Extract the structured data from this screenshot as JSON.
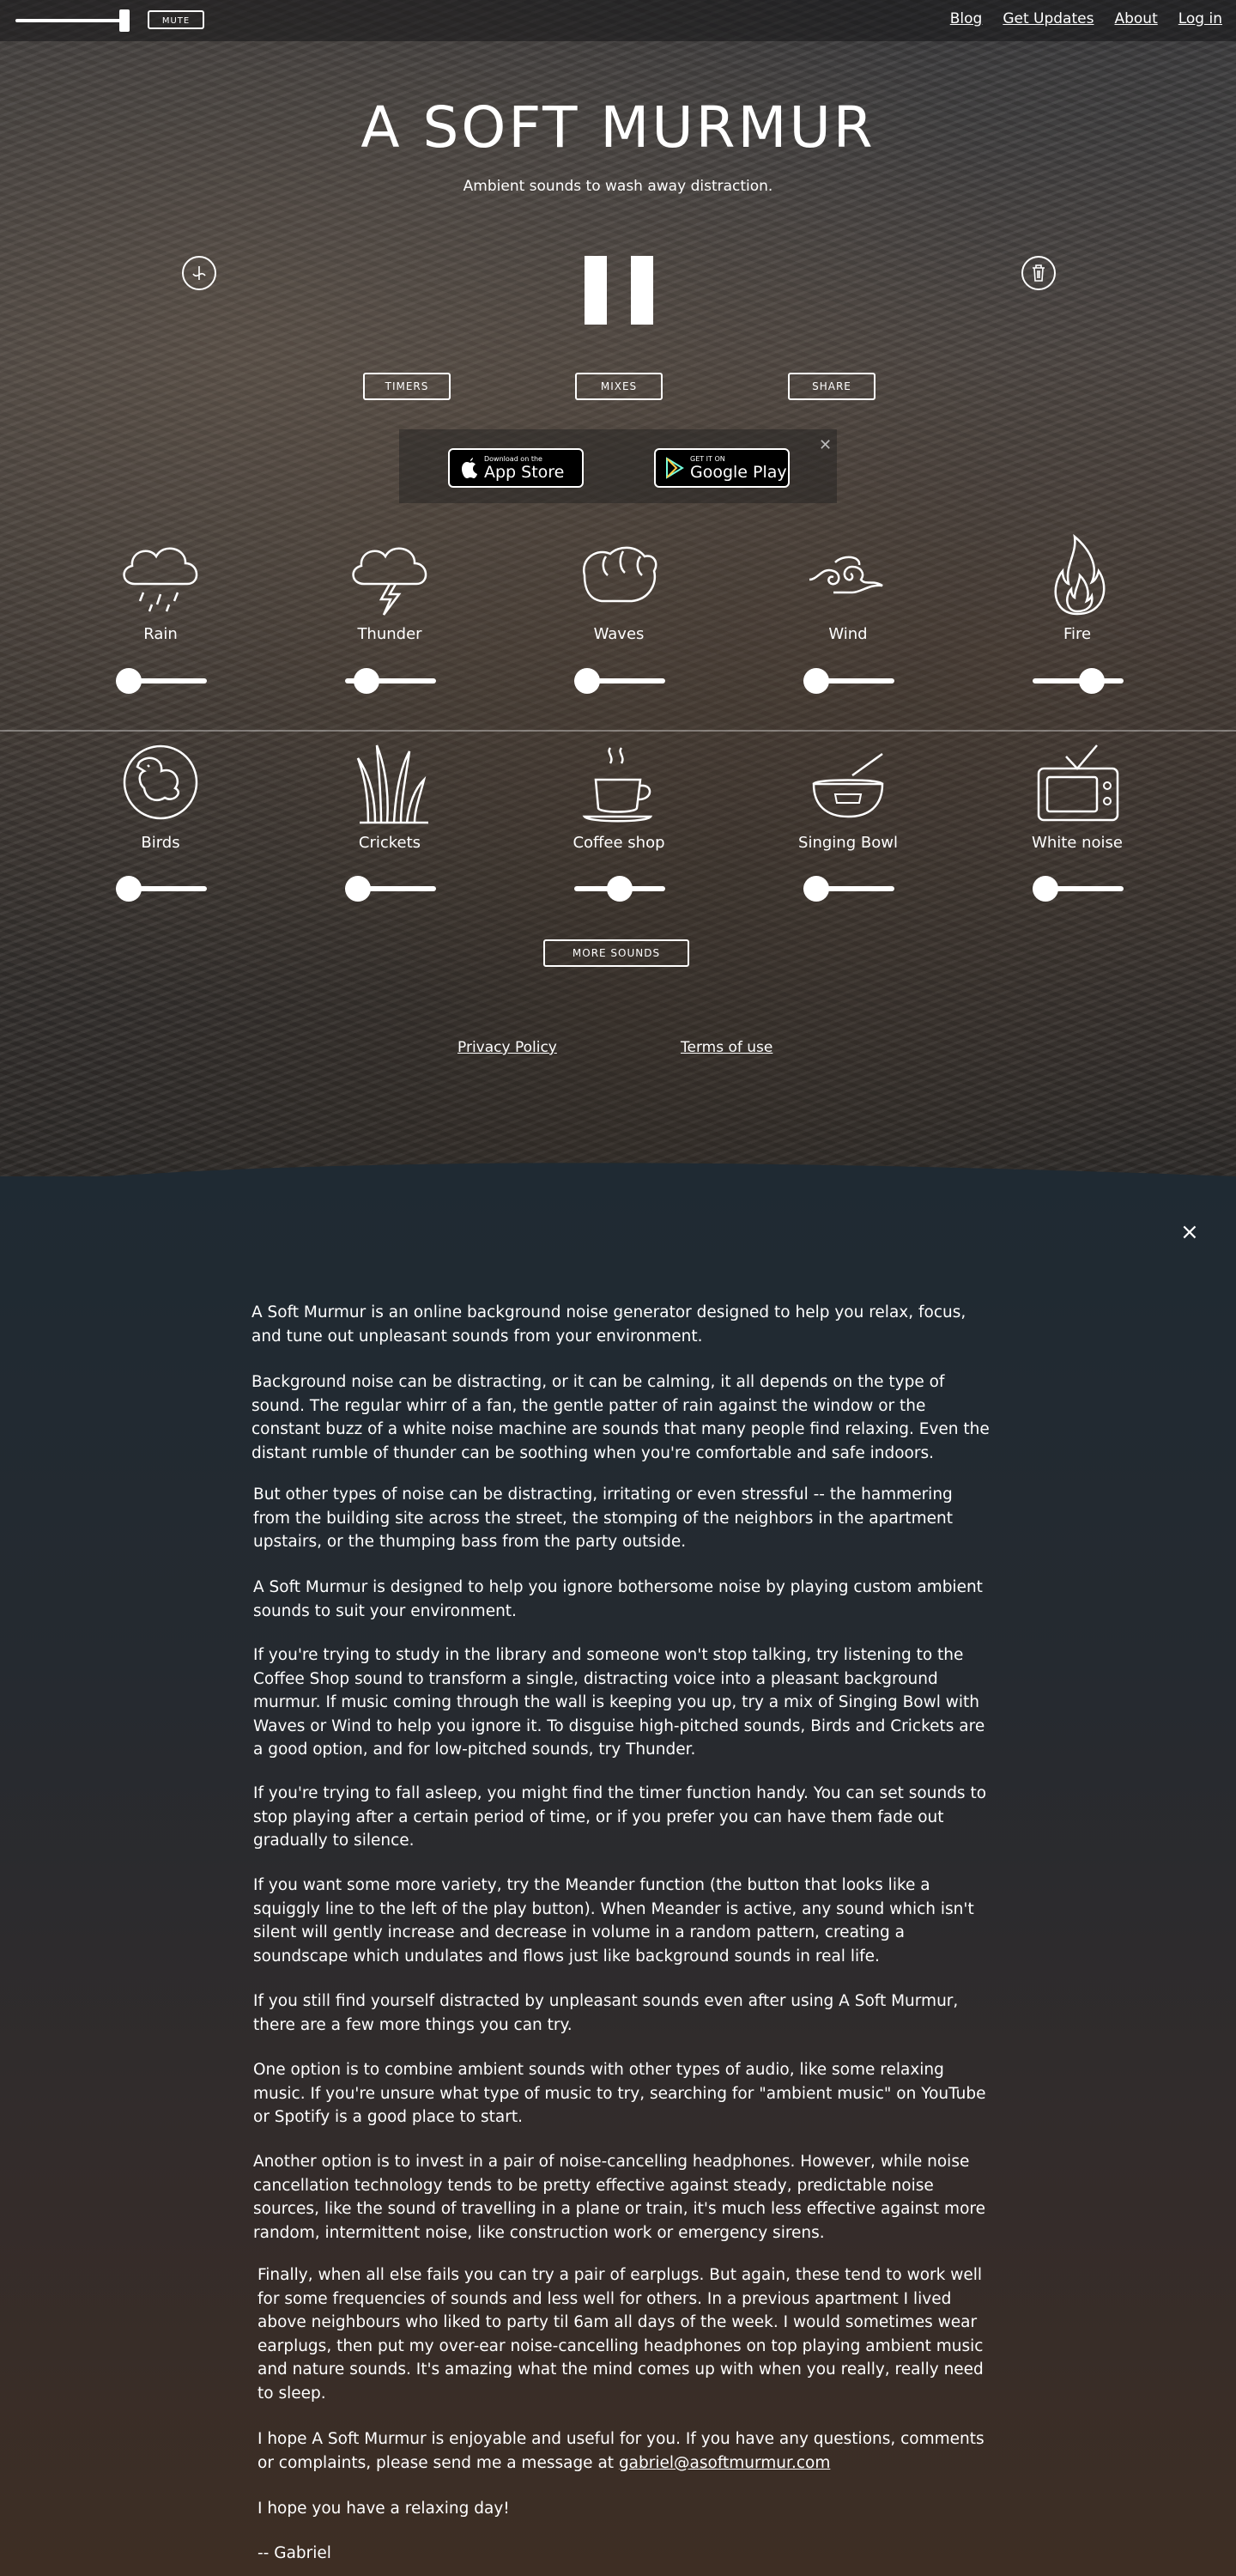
{
  "header": {
    "mute_label": "MUTE",
    "volume_level": 0.95,
    "nav": [
      "Blog",
      "Get Updates",
      "About",
      "Log in"
    ]
  },
  "hero": {
    "title": "A SOFT MURMUR",
    "subtitle": "Ambient sounds to wash away distraction."
  },
  "controls": {
    "timers": "TIMERS",
    "mixes": "MIXES",
    "share": "SHARE",
    "meander_icon": "meander-icon",
    "trash_icon": "trash-icon",
    "play_state": "pause"
  },
  "apps": {
    "app_store_small": "Download on the",
    "app_store_big": "App Store",
    "google_small": "GET IT ON",
    "google_big": "Google Play",
    "close": "✕"
  },
  "sounds": [
    {
      "label": "Rain",
      "icon": "rain-cloud-icon",
      "level": 0.1
    },
    {
      "label": "Thunder",
      "icon": "thunder-cloud-icon",
      "level": 0.25
    },
    {
      "label": "Waves",
      "icon": "waves-icon",
      "level": 0.1
    },
    {
      "label": "Wind",
      "icon": "wind-icon",
      "level": 0.1
    },
    {
      "label": "Fire",
      "icon": "fire-icon",
      "level": 0.7
    },
    {
      "label": "Birds",
      "icon": "bird-icon",
      "level": 0.0
    },
    {
      "label": "Crickets",
      "icon": "crickets-icon",
      "level": 0.15
    },
    {
      "label": "Coffee shop",
      "icon": "coffee-cup-icon",
      "level": 0.5
    },
    {
      "label": "Singing Bowl",
      "icon": "singing-bowl-icon",
      "level": 0.0
    },
    {
      "label": "White noise",
      "icon": "tv-icon",
      "level": 0.0
    }
  ],
  "more_sounds": "MORE SOUNDS",
  "footer": {
    "privacy": "Privacy Policy",
    "terms": "Terms of use"
  },
  "about": {
    "close": "×",
    "paragraphs": [
      "A Soft Murmur is an online background noise generator designed to help you relax, focus, and tune out unpleasant sounds from your environment.",
      "Background noise can be distracting, or it can be calming, it all depends on the type of sound. The regular whirr of a fan, the gentle patter of rain against the window or the constant buzz of a white noise machine are sounds that many people find relaxing. Even the distant rumble of thunder can be soothing when you're comfortable and safe indoors.",
      "But other types of noise can be distracting, irritating or even stressful -- the hammering from the building site across the street, the stomping of the neighbors in the apartment upstairs, or the thumping bass from the party outside.",
      "A Soft Murmur is designed to help you ignore bothersome noise by playing custom ambient sounds to suit your environment.",
      "If you're trying to study in the library and someone won't stop talking, try listening to the Coffee Shop sound to transform a single, distracting voice into a pleasant background murmur. If music coming through the wall is keeping you up, try a mix of Singing Bowl with Waves or Wind to help you ignore it. To disguise high-pitched sounds, Birds and Crickets are a good option, and for low-pitched sounds, try Thunder.",
      "If you're trying to fall asleep, you might find the timer function handy. You can set sounds to stop playing after a certain period of time, or if you prefer you can have them fade out gradually to silence.",
      "If you want some more variety, try the Meander function (the button that looks like a squiggly line to the left of the play button). When Meander is active, any sound which isn't silent will gently increase and decrease in volume in a random pattern, creating a soundscape which undulates and flows just like background sounds in real life.",
      "If you still find yourself distracted by unpleasant sounds even after using A Soft Murmur, there are a few more things you can try.",
      "One option is to combine ambient sounds with other types of audio, like some relaxing music. If you're unsure what type of music to try, searching for \"ambient music\" on YouTube or Spotify is a good place to start.",
      "Another option is to invest in a pair of noise-cancelling headphones. However, while noise cancellation technology tends to be pretty effective against steady, predictable noise sources, like the sound of travelling in a plane or train, it's much less effective against more random, intermittent noise, like construction work or emergency sirens.",
      "Finally, when all else fails you can try a pair of earplugs. But again, these tend to work well for some frequencies of sounds and less well for others. In a previous apartment I lived above neighbours who liked to party til 6am all days of the week. I would sometimes wear earplugs, then put my over-ear noise-cancelling headphones on top playing ambient music and nature sounds. It's amazing what the mind comes up with when you really, really need to sleep.",
      "I hope A Soft Murmur is enjoyable and useful for you. If you have any questions, comments or complaints, please send me a message at",
      "I hope you have a relaxing day!",
      "-- Gabriel"
    ],
    "email": "gabriel@asoftmurmur.com"
  }
}
